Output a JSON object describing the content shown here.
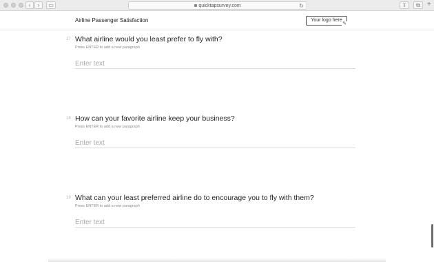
{
  "browser": {
    "url": "quicktapsurvey.com",
    "back_icon": "‹",
    "forward_icon": "›"
  },
  "header": {
    "title": "Airline Passenger Satisfaction",
    "logo_placeholder": "Your logo here"
  },
  "questions": [
    {
      "number": "17",
      "text": "What airline would you least prefer to fly with?",
      "hint": "Press ENTER to add a new paragraph",
      "placeholder": "Enter text"
    },
    {
      "number": "18",
      "text": "How can your favorite airline keep your business?",
      "hint": "Press ENTER to add a new paragraph",
      "placeholder": "Enter text"
    },
    {
      "number": "19",
      "text": "What can your least preferred airline do to encourage you to fly with them?",
      "hint": "Press ENTER to add a new paragraph",
      "placeholder": "Enter text"
    }
  ]
}
